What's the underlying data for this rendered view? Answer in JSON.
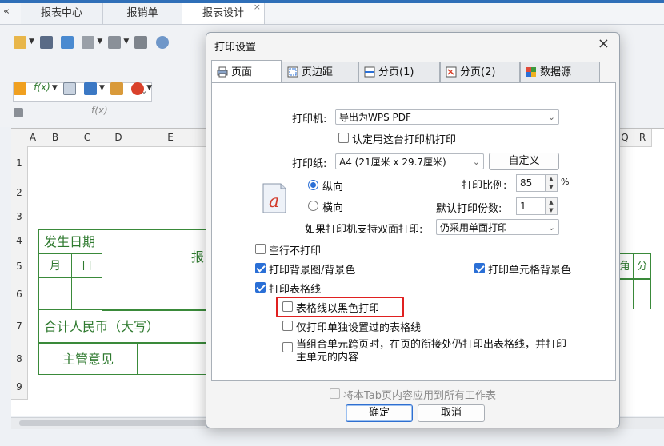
{
  "app": {
    "nav_glyph": "«",
    "tabs": [
      {
        "label": "报表中心"
      },
      {
        "label": "报销单"
      },
      {
        "label": "报表设计"
      }
    ],
    "tab_close_glyph": "×",
    "formula_glyph": "f(x)",
    "columns": [
      "A",
      "B",
      "C",
      "D",
      "E",
      "Q",
      "R"
    ],
    "rows": [
      "1",
      "2",
      "3",
      "4",
      "5",
      "6",
      "7",
      "8",
      "9"
    ],
    "sheet": {
      "date_header": "发生日期",
      "month": "月",
      "day": "日",
      "report_char": "报",
      "total_rmb": "合计人民币（大写）",
      "supervisor": "主管意见",
      "jiao": "角",
      "fen": "分"
    }
  },
  "dialog": {
    "title": "打印设置",
    "close_glyph": "×",
    "tabs": [
      {
        "label": "页面",
        "icon": "printer-icon",
        "active": true
      },
      {
        "label": "页边距",
        "icon": "margin-icon"
      },
      {
        "label": "分页(1)",
        "icon": "page-break-icon"
      },
      {
        "label": "分页(2)",
        "icon": "page-break-2-icon"
      },
      {
        "label": "数据源",
        "icon": "datasource-icon"
      }
    ],
    "printer_label": "打印机:",
    "printer_value": "导出为WPS PDF",
    "default_printer_label": "认定用这台打印机打印",
    "paper_label": "打印纸:",
    "paper_value": "A4 (21厘米 x 29.7厘米)",
    "custom_button": "自定义",
    "page_icon_glyph": "a",
    "portrait_label": "纵向",
    "landscape_label": "横向",
    "scale_label": "打印比例:",
    "scale_value": "85",
    "scale_unit": "%",
    "copies_label": "默认打印份数:",
    "copies_value": "1",
    "duplex_label": "如果打印机支持双面打印:",
    "duplex_value": "仍采用单面打印",
    "options": {
      "skip_empty_rows": "空行不打印",
      "print_background": "打印背景图/背景色",
      "print_cell_background": "打印单元格背景色",
      "print_gridlines": "打印表格线",
      "gridlines_black": "表格线以黑色打印",
      "only_set_gridlines": "仅打印单独设置过的表格线",
      "merged_cells_line1": "当组合单元跨页时，在页的衔接处仍打印出表格线，并打印",
      "merged_cells_line2": "主单元的内容"
    },
    "apply_all_label": "将本Tab页内容应用到所有工作表",
    "ok_button": "确定",
    "cancel_button": "取消",
    "colors": {
      "accent": "#2a6fd6",
      "highlight": "#e02020",
      "sheet_green": "#2f7a2f"
    }
  }
}
